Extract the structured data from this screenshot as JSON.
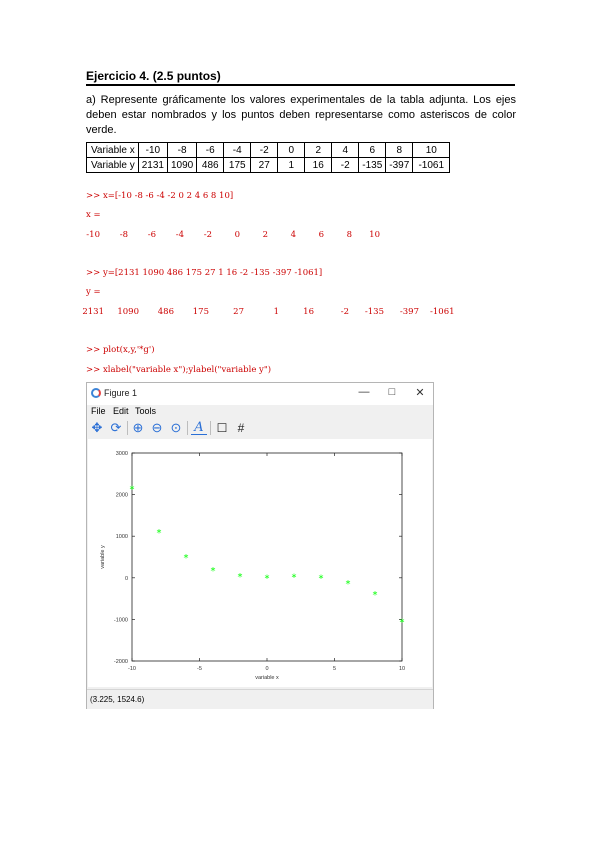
{
  "document": {
    "title": "Ejercicio 4. (2.5 puntos)",
    "paragraph": "a) Represente gráficamente los valores experimentales de la tabla adjunta. Los ejes deben estar nombrados y los puntos deben representarse como asteriscos de color verde.",
    "table": {
      "row_x_label": "Variable x",
      "row_y_label": "Variable y",
      "x_values": [
        "-10",
        "-8",
        "-6",
        "-4",
        "-2",
        "0",
        "2",
        "4",
        "6",
        "8",
        "10"
      ],
      "y_values": [
        "2131",
        "1090",
        "486",
        "175",
        "27",
        "1",
        "16",
        "-2",
        "-135",
        "-397",
        "-1061"
      ]
    }
  },
  "console": {
    "cmd1": ">> x=[-10 -8 -6 -4 -2 0 2 4 6 8 10]",
    "out1_label": "x =",
    "x_values": [
      "-10",
      "-8",
      "-6",
      "-4",
      "-2",
      "0",
      "2",
      "4",
      "6",
      "8",
      "10"
    ],
    "cmd2": ">> y=[2131 1090 486 175 27 1 16 -2 -135 -397 -1061]",
    "out2_label": "y =",
    "y_values": [
      "2131",
      "1090",
      "486",
      "175",
      "27",
      "1",
      "16",
      "-2",
      "-135",
      "-397",
      "-1061"
    ],
    "cmd3": ">> plot(x,y,'*g')",
    "cmd4": ">> xlabel(\"variable x\");ylabel(\"variable y\")"
  },
  "figure": {
    "window_title": "Figure 1",
    "minimize": "—",
    "maximize": "□",
    "close": "✕",
    "menu": [
      "File",
      "Edit",
      "Tools"
    ],
    "toolbar": [
      "pan-icon",
      "rotate-icon",
      "zoom-in-icon",
      "zoom-out-icon",
      "zoom-reset-icon",
      "text-icon",
      "axes-box-icon",
      "grid-icon"
    ],
    "status": "(3.225,  1524.6)",
    "marker_color": "#00ff00"
  },
  "chart_data": {
    "type": "scatter",
    "marker": "*",
    "color": "#00ff00",
    "x": [
      -10,
      -8,
      -6,
      -4,
      -2,
      0,
      2,
      4,
      6,
      8,
      10
    ],
    "y": [
      2131,
      1090,
      486,
      175,
      27,
      1,
      16,
      -2,
      -135,
      -397,
      -1061
    ],
    "xlabel": "variable x",
    "ylabel": "variable y",
    "xlim": [
      -10,
      10
    ],
    "ylim": [
      -2000,
      3000
    ],
    "xticks": [
      "-10",
      "-5",
      "0",
      "5",
      "10"
    ],
    "yticks": [
      "-2000",
      "-1000",
      "0",
      "1000",
      "2000",
      "3000"
    ],
    "grid": false
  }
}
